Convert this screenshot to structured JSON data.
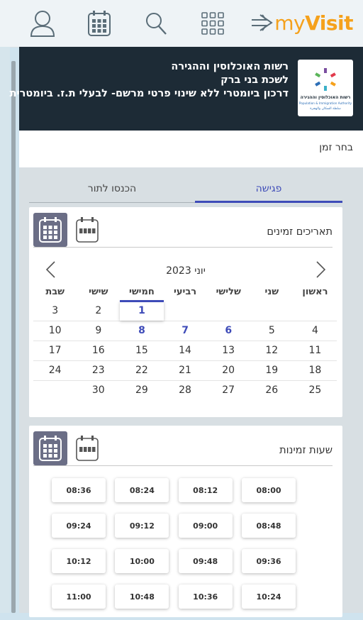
{
  "app": {
    "brand_prefix": "my",
    "brand_suffix": "Visit"
  },
  "colors": {
    "accent": "#3e4bb8",
    "brand": "#f5a11c",
    "header_bg": "#1d2b36",
    "toggle_active": "#6b6e86"
  },
  "topbar": {
    "icons": [
      "user-icon",
      "calendar-icon",
      "search-icon",
      "grid-menu-icon",
      "exit-arrow-icon"
    ]
  },
  "header": {
    "logo_alt": "רשות האוכלוסין וההגירה",
    "line1": "רשות האוכלוסין וההגירה",
    "line2": "לשכת בני ברק",
    "line3": "דרכון ביומטרי ללא שינוי פרטי מרשם- לבעלי ת.ז. ביומטרית",
    "logo_text_he": "רשות האוכלוסין וההגירה",
    "logo_text_en": "Population & Immigration Authority",
    "logo_text_ar": "سلطة السكان والهجرة"
  },
  "step": {
    "title": "בחר זמן"
  },
  "tabs": {
    "meeting": "פגישה",
    "queue": "הכנסו לתור",
    "active": "meeting"
  },
  "dates": {
    "title": "תאריכים זמינים",
    "month_title": "יוני 2023",
    "weekdays": [
      "ראשון",
      "שני",
      "שלישי",
      "רביעי",
      "חמישי",
      "שישי",
      "שבת"
    ],
    "weeks": [
      [
        "",
        "",
        "",
        "",
        "1",
        "2",
        "3"
      ],
      [
        "4",
        "5",
        "6",
        "7",
        "8",
        "9",
        "10"
      ],
      [
        "11",
        "12",
        "13",
        "14",
        "15",
        "16",
        "17"
      ],
      [
        "18",
        "19",
        "20",
        "21",
        "22",
        "23",
        "24"
      ],
      [
        "25",
        "26",
        "27",
        "28",
        "29",
        "30",
        ""
      ]
    ],
    "available": [
      "1",
      "6",
      "7",
      "8"
    ],
    "selected": "1"
  },
  "hours": {
    "title": "שעות זמינות",
    "slots": [
      [
        "08:00",
        "08:12",
        "08:24",
        "08:36"
      ],
      [
        "08:48",
        "09:00",
        "09:12",
        "09:24"
      ],
      [
        "09:36",
        "09:48",
        "10:00",
        "10:12"
      ],
      [
        "10:24",
        "10:36",
        "10:48",
        "11:00"
      ]
    ]
  }
}
